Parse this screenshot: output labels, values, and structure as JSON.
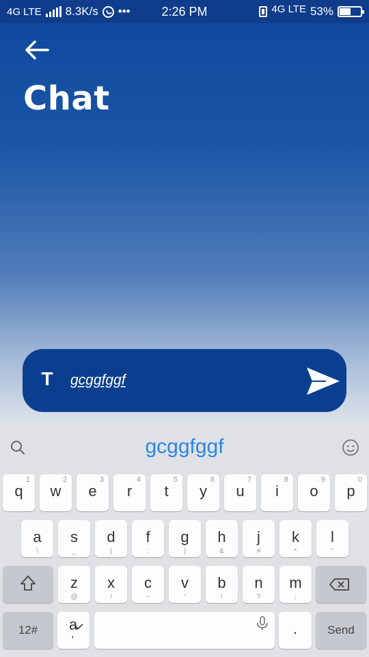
{
  "status_bar": {
    "network": "4G LTE",
    "speed": "8.3K/s",
    "more": "•••",
    "time": "2:26 PM",
    "network2": "4G LTE",
    "battery": "53%",
    "battery_level": 0.53
  },
  "header": {
    "back_icon": "arrow-left-icon",
    "title": "Chat"
  },
  "composer": {
    "format_icon": "T",
    "message_value": "gcggfggf",
    "send_icon": "send-icon"
  },
  "keyboard": {
    "suggestion": "gcggfggf",
    "row1": [
      {
        "key": "q",
        "alt": "1"
      },
      {
        "key": "w",
        "alt": "2"
      },
      {
        "key": "e",
        "alt": "3"
      },
      {
        "key": "r",
        "alt": "4"
      },
      {
        "key": "t",
        "alt": "5"
      },
      {
        "key": "y",
        "alt": "6"
      },
      {
        "key": "u",
        "alt": "7"
      },
      {
        "key": "i",
        "alt": "8"
      },
      {
        "key": "o",
        "alt": "9"
      },
      {
        "key": "p",
        "alt": "0"
      }
    ],
    "row2": [
      {
        "key": "a",
        "alt": "\\"
      },
      {
        "key": "s",
        "alt": "_"
      },
      {
        "key": "d",
        "alt": "("
      },
      {
        "key": "f",
        "alt": ":"
      },
      {
        "key": "g",
        "alt": ")"
      },
      {
        "key": "h",
        "alt": "&"
      },
      {
        "key": "j",
        "alt": "#"
      },
      {
        "key": "k",
        "alt": "*"
      },
      {
        "key": "l",
        "alt": "\""
      }
    ],
    "row3": [
      {
        "key": "z",
        "alt": "@"
      },
      {
        "key": "x",
        "alt": "/"
      },
      {
        "key": "c",
        "alt": "−"
      },
      {
        "key": "v",
        "alt": "'"
      },
      {
        "key": "b",
        "alt": "!"
      },
      {
        "key": "n",
        "alt": "?"
      },
      {
        "key": "m",
        "alt": ";"
      }
    ],
    "sym_label": "12#",
    "lang_label": "a",
    "lang_sub": ",",
    "period": ".",
    "send_label": "Send"
  }
}
